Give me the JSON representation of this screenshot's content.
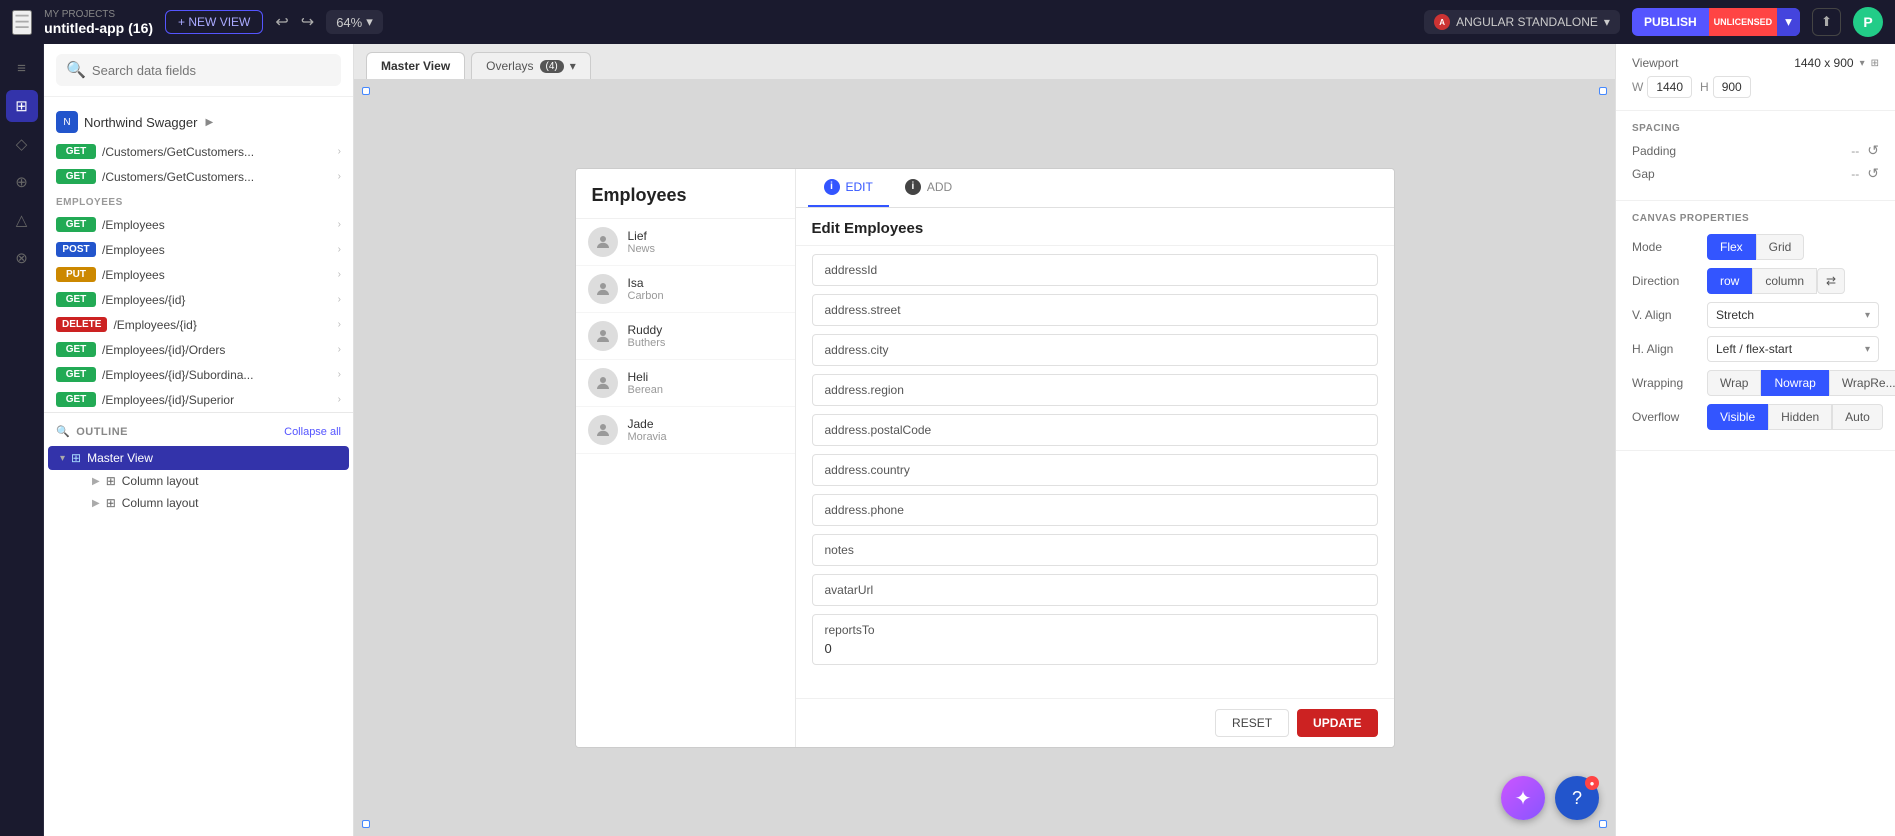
{
  "topbar": {
    "menu_icon": "☰",
    "project_sub": "MY PROJECTS",
    "project_name": "untitled-app (16)",
    "new_view_label": "+ NEW VIEW",
    "undo_icon": "↩",
    "redo_icon": "↪",
    "zoom_level": "64%",
    "framework": "ANGULAR STANDALONE",
    "publish_label": "PUBLISH",
    "publish_badge": "UNLICENSED",
    "share_icon": "⬆",
    "avatar_letter": "P"
  },
  "left_sidebar": {
    "icons": [
      "≡",
      "⊞",
      "◇",
      "⊕",
      "△",
      "⊗"
    ]
  },
  "data_panel": {
    "search_placeholder": "Search data fields",
    "source": {
      "icon": "N",
      "label": "Northwind Swagger",
      "chevron": "▶"
    },
    "endpoints": [
      {
        "method": "GET",
        "path": "/Customers/GetCustomers...",
        "type": "get"
      },
      {
        "method": "GET",
        "path": "/Customers/GetCustomers...",
        "type": "get"
      }
    ],
    "group_label": "EMPLOYEES",
    "employee_endpoints": [
      {
        "method": "GET",
        "path": "/Employees",
        "type": "get"
      },
      {
        "method": "POST",
        "path": "/Employees",
        "type": "post"
      },
      {
        "method": "PUT",
        "path": "/Employees",
        "type": "put"
      },
      {
        "method": "GET",
        "path": "/Employees/{id}",
        "type": "get"
      },
      {
        "method": "DELETE",
        "path": "/Employees/{id}",
        "type": "delete"
      },
      {
        "method": "GET",
        "path": "/Employees/{id}/Orders",
        "type": "get"
      },
      {
        "method": "GET",
        "path": "/Employees/{id}/Subordina...",
        "type": "get"
      },
      {
        "method": "GET",
        "path": "/Employees/{id}/Superior",
        "type": "get"
      }
    ]
  },
  "outline": {
    "title": "OUTLINE",
    "collapse_label": "Collapse all",
    "master_view_label": "Master View",
    "items": [
      {
        "label": "Column layout"
      },
      {
        "label": "Column layout"
      }
    ]
  },
  "canvas": {
    "master_view_tab": "Master View",
    "overlays_tab": "Overlays (4)",
    "app": {
      "title": "Employees",
      "employees": [
        {
          "name": "Lief",
          "sub": "News"
        },
        {
          "name": "Isa",
          "sub": "Carbon"
        },
        {
          "name": "Ruddy",
          "sub": "Buthers"
        },
        {
          "name": "Heli",
          "sub": "Berean"
        },
        {
          "name": "Jade",
          "sub": "Moravia"
        }
      ],
      "edit_tab_label": "EDIT",
      "add_tab_label": "ADD",
      "edit_title": "Edit Employees",
      "fields": [
        {
          "label": "addressId",
          "value": ""
        },
        {
          "label": "address.street",
          "value": ""
        },
        {
          "label": "address.city",
          "value": ""
        },
        {
          "label": "address.region",
          "value": ""
        },
        {
          "label": "address.postalCode",
          "value": ""
        },
        {
          "label": "address.country",
          "value": ""
        },
        {
          "label": "address.phone",
          "value": ""
        },
        {
          "label": "notes",
          "value": ""
        },
        {
          "label": "avatarUrl",
          "value": ""
        },
        {
          "label": "reportsTo",
          "value": "0"
        }
      ],
      "reset_label": "RESET",
      "update_label": "UPDATE"
    }
  },
  "props_panel": {
    "viewport_label": "Viewport",
    "viewport_value": "1440 x 900",
    "w_label": "W",
    "w_value": "1440",
    "h_label": "H",
    "h_value": "900",
    "spacing_label": "SPACING",
    "padding_label": "Padding",
    "padding_value": "--",
    "gap_label": "Gap",
    "gap_value": "--",
    "canvas_props_label": "CANVAS PROPERTIES",
    "mode_label": "Mode",
    "flex_label": "Flex",
    "grid_label": "Grid",
    "direction_label": "Direction",
    "row_label": "row",
    "column_label": "column",
    "valign_label": "V. Align",
    "valign_value": "Stretch",
    "halign_label": "H. Align",
    "halign_value": "Left / flex-start",
    "wrapping_label": "Wrapping",
    "wrap_label": "Wrap",
    "nowrap_label": "Nowrap",
    "wrapre_label": "WrapRe...",
    "overflow_label": "Overflow",
    "visible_label": "Visible",
    "hidden_label": "Hidden",
    "auto_label": "Auto"
  }
}
